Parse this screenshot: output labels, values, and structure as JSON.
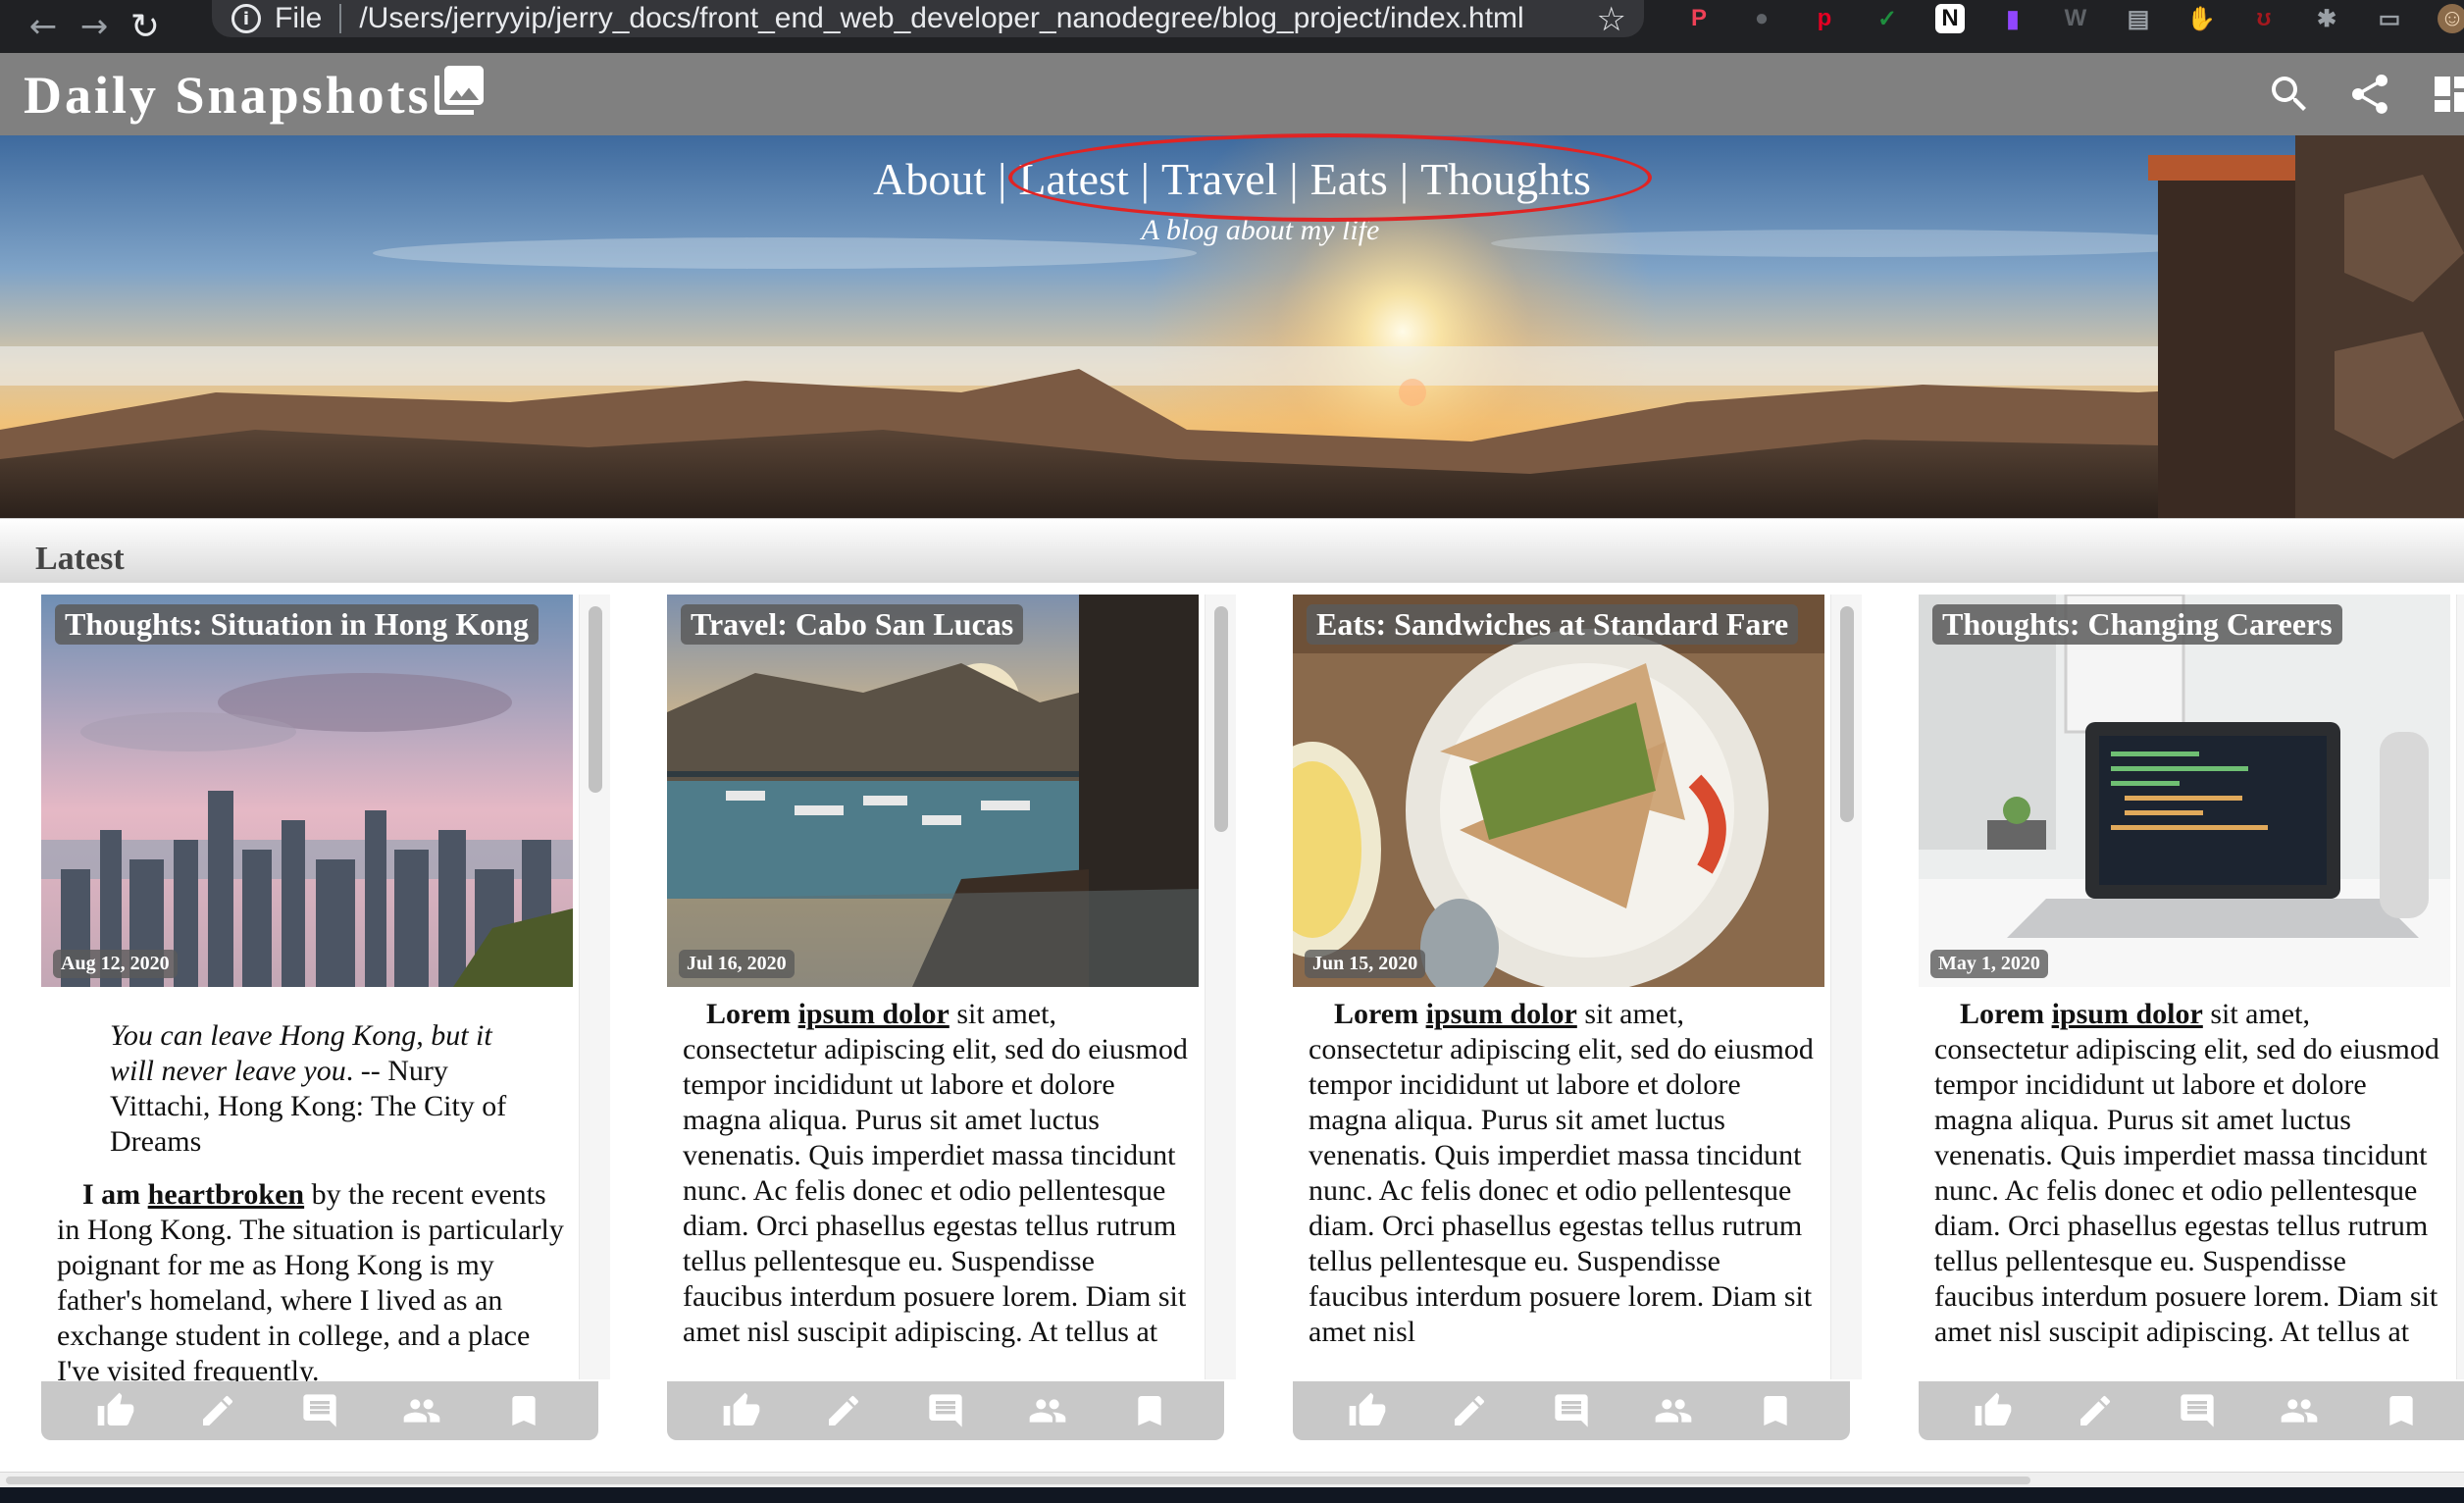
{
  "browser": {
    "scheme": "File",
    "url": "/Users/jerryyip/jerry_docs/front_end_web_developer_nanodegree/blog_project/index.html",
    "extensions": [
      {
        "name": "pocket-icon",
        "color": "#ef4056",
        "glyph": "P"
      },
      {
        "name": "circle-icon",
        "color": "#5f6368",
        "glyph": "●"
      },
      {
        "name": "pinterest-icon",
        "color": "#e60023",
        "glyph": "p"
      },
      {
        "name": "check-icon",
        "color": "#1e8e3e",
        "glyph": "✓"
      },
      {
        "name": "notion-icon",
        "color": "#ffffff",
        "glyph": "N"
      },
      {
        "name": "twitch-icon",
        "color": "#9146ff",
        "glyph": "▮"
      },
      {
        "name": "w-icon",
        "color": "#5f6368",
        "glyph": "W"
      },
      {
        "name": "doc-icon",
        "color": "#9aa0a6",
        "glyph": "▤"
      },
      {
        "name": "hand-icon",
        "color": "#e52222",
        "glyph": "✋"
      },
      {
        "name": "ublock-icon",
        "color": "#a3181e",
        "glyph": "ʊ"
      },
      {
        "name": "puzzle-icon",
        "color": "#9aa0a6",
        "glyph": "✱"
      },
      {
        "name": "cast-icon",
        "color": "#9aa0a6",
        "glyph": "▭"
      },
      {
        "name": "avatar",
        "color": "#8b6b4a",
        "glyph": "☺"
      }
    ]
  },
  "header": {
    "title": "Daily Snapshots"
  },
  "hero": {
    "nav": [
      "About",
      "Latest",
      "Travel",
      "Eats",
      "Thoughts"
    ],
    "separator": "|",
    "tagline": "A blog about my life"
  },
  "section": {
    "title": "Latest"
  },
  "cards": [
    {
      "label": "Thoughts: Situation in Hong Kong",
      "date": "Aug 12, 2020",
      "quote_a": "You can leave Hong Kong, but it will never leave you",
      "quote_b": ". -- Nury Vittachi, Hong Kong: The City of Dreams",
      "lead": "I am",
      "link": "heartbroken",
      "body": "by the recent events in Hong Kong. The situation is particularly poignant for me as Hong Kong is my father's homeland, where I lived as an exchange student in college, and a place I've visited frequently."
    },
    {
      "label": "Travel: Cabo San Lucas",
      "date": "Jul 16, 2020",
      "lead": "Lorem",
      "link": "ipsum dolor",
      "body": "sit amet, consectetur adipiscing elit, sed do eiusmod tempor incididunt ut labore et dolore magna aliqua. Purus sit amet luctus venenatis. Quis imperdiet massa tincidunt nunc. Ac felis donec et odio pellentesque diam. Orci phasellus egestas tellus rutrum tellus pellentesque eu. Suspendisse faucibus interdum posuere lorem. Diam sit amet nisl suscipit adipiscing. At tellus at"
    },
    {
      "label": "Eats: Sandwiches at Standard Fare",
      "date": "Jun 15, 2020",
      "lead": "Lorem",
      "link": "ipsum dolor",
      "body": "sit amet, consectetur adipiscing elit, sed do eiusmod tempor incididunt ut labore et dolore magna aliqua. Purus sit amet luctus venenatis. Quis imperdiet massa tincidunt nunc. Ac felis donec et odio pellentesque diam. Orci phasellus egestas tellus rutrum tellus pellentesque eu. Suspendisse faucibus interdum posuere lorem. Diam sit amet nisl"
    },
    {
      "label": "Thoughts: Changing Careers",
      "date": "May 1, 2020",
      "lead": "Lorem",
      "link": "ipsum dolor",
      "body": "sit amet, consectetur adipiscing elit, sed do eiusmod tempor incididunt ut labore et dolore magna aliqua. Purus sit amet luctus venenatis. Quis imperdiet massa tincidunt nunc. Ac felis donec et odio pellentesque diam. Orci phasellus egestas tellus rutrum tellus pellentesque eu. Suspendisse faucibus interdum posuere lorem. Diam sit amet nisl suscipit adipiscing. At tellus at"
    }
  ],
  "card_actions": [
    "thumb-up-icon",
    "edit-icon",
    "comment-icon",
    "people-icon",
    "bookmark-icon"
  ],
  "colors": {
    "header_bg": "#808080",
    "annotation_circle": "#e02424",
    "action_bar": "#c8c8c8"
  }
}
